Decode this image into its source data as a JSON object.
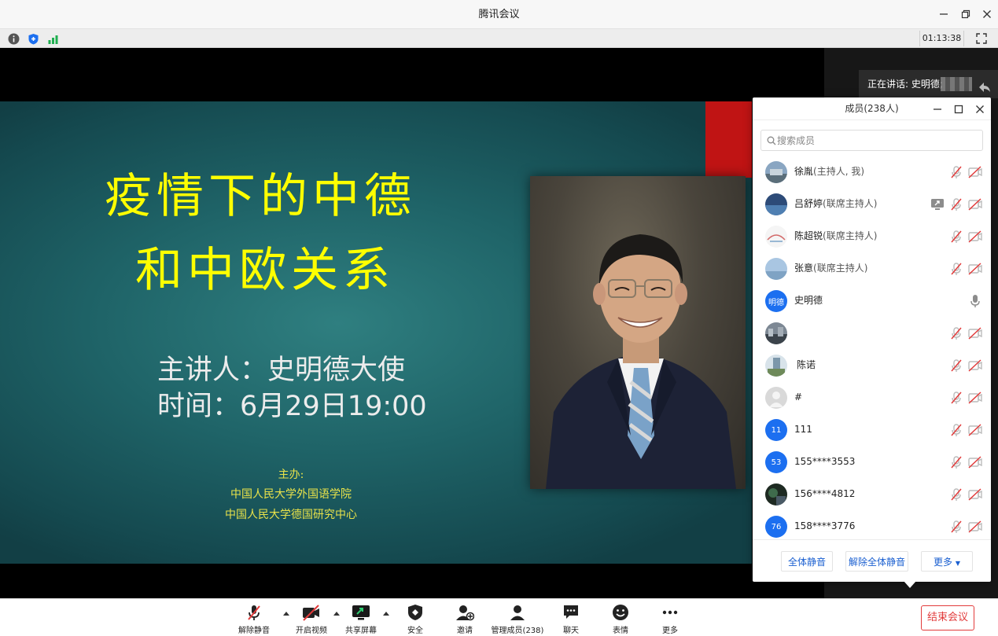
{
  "window": {
    "title": "腾讯会议",
    "timer": "01:13:38"
  },
  "speaking": {
    "label": "正在讲话: 史明德;"
  },
  "slide": {
    "title_line1": "疫情下的中德",
    "title_line2": "和中欧关系",
    "speaker": "主讲人：史明德大使",
    "time": "时间：6月29日19:00",
    "host_label": "主办:",
    "host_org1": "中国人民大学外国语学院",
    "host_org2": "中国人民大学德国研究中心"
  },
  "members": {
    "title": "成员(238人)",
    "search_placeholder": "搜索成员",
    "list": [
      {
        "name": "徐胤",
        "role": "(主持人, 我)",
        "avatar": "photo-landscape",
        "mic": "muted",
        "video": "off",
        "share": false
      },
      {
        "name": "吕舒婷",
        "role": "(联席主持人)",
        "avatar": "photo-sky",
        "mic": "muted",
        "video": "off",
        "share": true
      },
      {
        "name": "陈超锐",
        "role": "(联席主持人)",
        "avatar": "photo-sketch",
        "mic": "muted",
        "video": "off",
        "share": false
      },
      {
        "name": "张意",
        "role": "(联席主持人)",
        "avatar": "photo-sea",
        "mic": "muted",
        "video": "off",
        "share": false
      },
      {
        "name": "史明德",
        "role": "",
        "avatar_text": "明德",
        "avatar_color": "#1c6ff0",
        "mic": "active",
        "video": "none",
        "share": false
      },
      {
        "name": "",
        "role": "",
        "avatar": "photo-city",
        "mic": "muted",
        "video": "off",
        "share": false
      },
      {
        "name": "陈诺",
        "role": "",
        "avatar": "photo-building",
        "mic": "muted",
        "video": "off",
        "share": false
      },
      {
        "name": "#",
        "role": "",
        "avatar": "default-person",
        "mic": "muted",
        "video": "off",
        "share": false
      },
      {
        "name": "111",
        "role": "",
        "avatar_text": "11",
        "avatar_color": "#1c6ff0",
        "mic": "muted",
        "video": "off",
        "share": false
      },
      {
        "name": "155****3553",
        "role": "",
        "avatar_text": "53",
        "avatar_color": "#1c6ff0",
        "mic": "muted",
        "video": "off",
        "share": false
      },
      {
        "name": "156****4812",
        "role": "",
        "avatar": "photo-dark",
        "mic": "muted",
        "video": "off",
        "share": false
      },
      {
        "name": "158****3776",
        "role": "",
        "avatar_text": "76",
        "avatar_color": "#1c6ff0",
        "mic": "muted",
        "video": "off",
        "share": false
      }
    ],
    "footer": {
      "mute_all": "全体静音",
      "unmute_all": "解除全体静音",
      "more": "更多"
    }
  },
  "toolbar": {
    "unmute": "解除静音",
    "video": "开启视频",
    "share": "共享屏幕",
    "security": "安全",
    "invite": "邀请",
    "manage_members": "管理成员(238)",
    "chat": "聊天",
    "reactions": "表情",
    "more": "更多",
    "end_meeting": "结束会议"
  },
  "colors": {
    "accent": "#1c6ff0",
    "danger": "#e23b3b",
    "slide_title": "#ffff00",
    "slide_small": "#e8e24a"
  }
}
